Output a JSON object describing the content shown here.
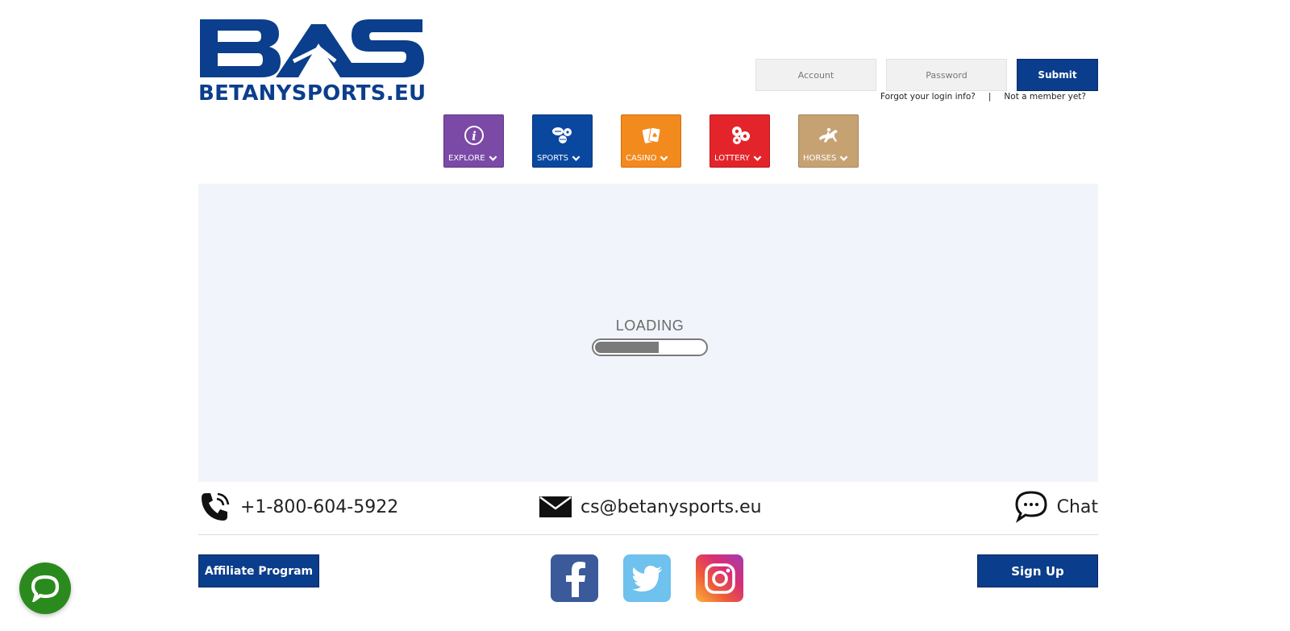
{
  "brand": {
    "logo_letters": "BAS",
    "site_name": "BETANYSPORTS.EU",
    "color_primary": "#0b3e8c"
  },
  "login": {
    "account_placeholder": "Account",
    "password_placeholder": "Password",
    "submit_label": "Submit",
    "forgot_label": "Forgot your login info?",
    "separator": "|",
    "not_member_label": "Not a member yet?"
  },
  "nav": {
    "tiles": [
      {
        "label": "EXPLORE",
        "icon": "info-icon",
        "color": "#7a4aa6"
      },
      {
        "label": "SPORTS",
        "icon": "sports-balls-icon",
        "color": "#0a48a0"
      },
      {
        "label": "CASINO",
        "icon": "cards-icon",
        "color": "#f28a1e"
      },
      {
        "label": "LOTTERY",
        "icon": "lottery-balls-icon",
        "color": "#e3252b"
      },
      {
        "label": "HORSES",
        "icon": "horse-racing-icon",
        "color": "#c6a273"
      }
    ]
  },
  "content": {
    "loading_label": "LOADING",
    "loading_progress": 0.58
  },
  "contact": {
    "phone": "+1-800-604-5922",
    "email": "cs@betanysports.eu",
    "chat_label": "Chat"
  },
  "footer": {
    "affiliate_label": "Affiliate Program",
    "signup_label": "Sign Up",
    "social": [
      "facebook-icon",
      "twitter-icon",
      "instagram-icon"
    ]
  }
}
